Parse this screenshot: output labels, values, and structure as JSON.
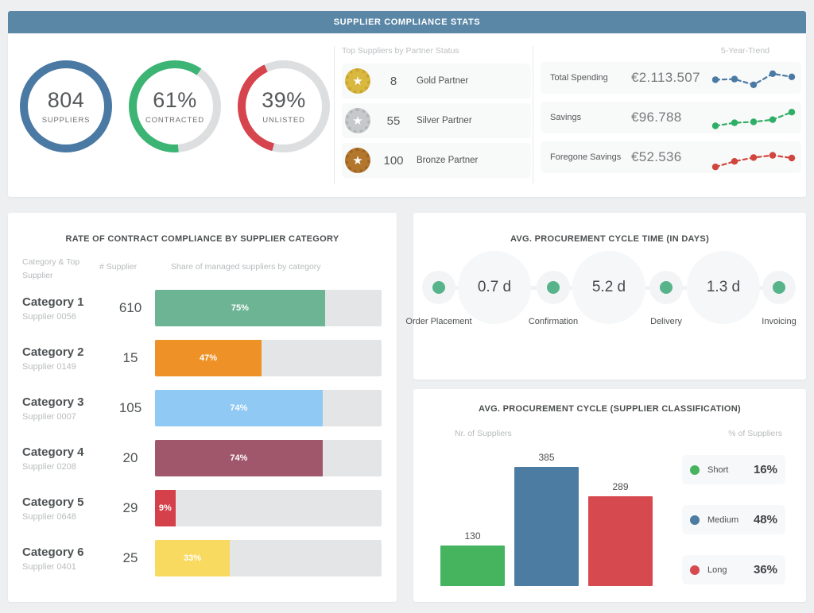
{
  "theme": {
    "header_bg": "#5b87a7",
    "page_bg": "#edeff0",
    "card_bg": "#ffffff",
    "donut_track": "#dcdedf",
    "bar_track": "#e4e5e6",
    "tile_bg": "#f8f9f9",
    "cycle_dot_color": "#57b389"
  },
  "header": {
    "title": "SUPPLIER COMPLIANCE STATS"
  },
  "kpis": [
    {
      "value": "804",
      "label": "SUPPLIERS",
      "pct": 100,
      "color": "#4a79a3",
      "rotate": 0
    },
    {
      "value": "61%",
      "label": "CONTRACTED",
      "pct": 61,
      "color": "#3cb474",
      "rotate": 35
    },
    {
      "value": "39%",
      "label": "UNLISTED",
      "pct": 39,
      "color": "#d6444e",
      "rotate": -25
    }
  ],
  "partner_status": {
    "heading": "Top Suppliers by Partner Status",
    "rows": [
      {
        "icon": "gold-badge-icon",
        "count": "8",
        "label": "Gold Partner",
        "color": "#d9b83f",
        "ring_color": "#c8a531"
      },
      {
        "icon": "silver-badge-icon",
        "count": "55",
        "label": "Silver Partner",
        "color": "#c6c9cc",
        "ring_color": "#b2b6b9"
      },
      {
        "icon": "bronze-badge-icon",
        "count": "100",
        "label": "Bronze Partner",
        "color": "#b3762d",
        "ring_color": "#9f6524"
      }
    ]
  },
  "trends": {
    "heading": "5-Year-Trend",
    "rows": [
      {
        "label": "Total Spending",
        "value": "€2.113.507",
        "color": "#4a79a3",
        "points": [
          45,
          48,
          22,
          72,
          58
        ]
      },
      {
        "label": "Savings",
        "value": "€96.788",
        "color": "#2fae66",
        "points": [
          16,
          30,
          34,
          44,
          78
        ]
      },
      {
        "label": "Foregone Savings",
        "value": "€52.536",
        "color": "#d0453c",
        "points": [
          10,
          35,
          52,
          62,
          50
        ]
      }
    ]
  },
  "compliance": {
    "title": "RATE OF CONTRACT COMPLIANCE BY SUPPLIER CATEGORY",
    "columns": [
      "Category & Top Supplier",
      "# Supplier",
      "Share of managed suppliers by category"
    ],
    "rows": [
      {
        "category": "Category 1",
        "supplier": "Supplier 0056",
        "count": "610",
        "pct": 75,
        "pct_label": "75%",
        "color": "#6cb493"
      },
      {
        "category": "Category 2",
        "supplier": "Supplier 0149",
        "count": "15",
        "pct": 47,
        "pct_label": "47%",
        "color": "#ee9227"
      },
      {
        "category": "Category 3",
        "supplier": "Supplier 0007",
        "count": "105",
        "pct": 74,
        "pct_label": "74%",
        "color": "#8fc9f4"
      },
      {
        "category": "Category 4",
        "supplier": "Supplier 0208",
        "count": "20",
        "pct": 74,
        "pct_label": "74%",
        "color": "#a0566b"
      },
      {
        "category": "Category 5",
        "supplier": "Supplier 0648",
        "count": "29",
        "pct": 9,
        "pct_label": "9%",
        "color": "#d4414b"
      },
      {
        "category": "Category 6",
        "supplier": "Supplier 0401",
        "count": "25",
        "pct": 33,
        "pct_label": "33%",
        "color": "#f8da60"
      }
    ]
  },
  "cycle_time": {
    "title": "AVG. PROCUREMENT CYCLE TIME (IN DAYS)",
    "stages": [
      "Order Placement",
      "Confirmation",
      "Delivery",
      "Invoicing"
    ],
    "durations": [
      "0.7 d",
      "5.2 d",
      "1.3 d"
    ]
  },
  "classification": {
    "title": "AVG. PROCUREMENT CYCLE (SUPPLIER CLASSIFICATION)",
    "left_label": "Nr. of Suppliers",
    "right_label": "% of Suppliers",
    "bars": [
      {
        "label": "Short",
        "value": 130,
        "value_label": "130",
        "pct": "16%",
        "color": "#46b35f"
      },
      {
        "label": "Medium",
        "value": 385,
        "value_label": "385",
        "pct": "48%",
        "color": "#4d7ca3"
      },
      {
        "label": "Long",
        "value": 289,
        "value_label": "289",
        "pct": "36%",
        "color": "#d6494f"
      }
    ]
  },
  "chart_data": [
    {
      "type": "donut",
      "label": "SUPPLIERS",
      "value": 804,
      "pct": 100
    },
    {
      "type": "donut",
      "label": "CONTRACTED",
      "pct": 61
    },
    {
      "type": "donut",
      "label": "UNLISTED",
      "pct": 39
    },
    {
      "type": "line",
      "title": "Total Spending 5-Year-Trend",
      "value": "€2.113.507",
      "points_relative": [
        45,
        48,
        22,
        72,
        58
      ]
    },
    {
      "type": "line",
      "title": "Savings 5-Year-Trend",
      "value": "€96.788",
      "points_relative": [
        16,
        30,
        34,
        44,
        78
      ]
    },
    {
      "type": "line",
      "title": "Foregone Savings 5-Year-Trend",
      "value": "€52.536",
      "points_relative": [
        10,
        35,
        52,
        62,
        50
      ]
    },
    {
      "type": "bar",
      "title": "RATE OF CONTRACT COMPLIANCE BY SUPPLIER CATEGORY",
      "categories": [
        "Category 1",
        "Category 2",
        "Category 3",
        "Category 4",
        "Category 5",
        "Category 6"
      ],
      "top_suppliers": [
        "Supplier 0056",
        "Supplier 0149",
        "Supplier 0007",
        "Supplier 0208",
        "Supplier 0648",
        "Supplier 0401"
      ],
      "supplier_counts": [
        610,
        15,
        105,
        20,
        29,
        25
      ],
      "values_pct": [
        75,
        47,
        74,
        74,
        9,
        33
      ]
    },
    {
      "type": "timeline",
      "title": "AVG. PROCUREMENT CYCLE TIME (IN DAYS)",
      "stages": [
        "Order Placement",
        "Confirmation",
        "Delivery",
        "Invoicing"
      ],
      "durations_days": [
        0.7,
        5.2,
        1.3
      ]
    },
    {
      "type": "bar",
      "title": "AVG. PROCUREMENT CYCLE (SUPPLIER CLASSIFICATION)",
      "categories": [
        "Short",
        "Medium",
        "Long"
      ],
      "values": [
        130,
        385,
        289
      ],
      "percentages": [
        "16%",
        "48%",
        "36%"
      ]
    }
  ]
}
